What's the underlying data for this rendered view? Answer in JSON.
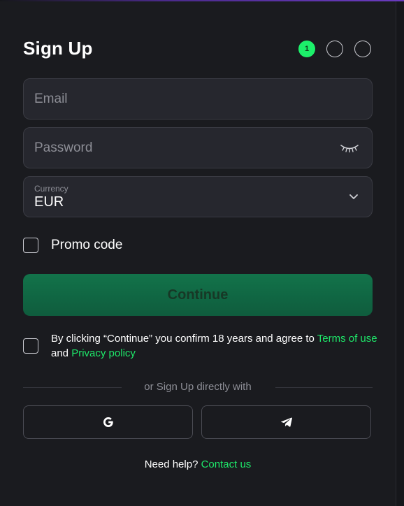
{
  "form": {
    "title": "Sign Up",
    "steps": [
      {
        "label": "1",
        "active": true
      },
      {
        "label": "",
        "active": false
      },
      {
        "label": "",
        "active": false
      }
    ],
    "email": {
      "placeholder": "Email"
    },
    "password": {
      "placeholder": "Password",
      "toggle_icon": "eye-closed-icon"
    },
    "currency": {
      "label": "Currency",
      "value": "EUR",
      "icon": "chevron-down-icon"
    },
    "promo": {
      "label": "Promo code",
      "checked": false
    },
    "continue_label": "Continue",
    "terms": {
      "checked": false,
      "text_before": "By clicking “Continue” you confirm 18 years and agree to ",
      "terms_link": "Terms of use",
      "text_middle": " and ",
      "privacy_link": "Privacy policy"
    },
    "social": {
      "divider_text": "or Sign Up directly with",
      "buttons": [
        {
          "name": "google",
          "icon": "google-icon"
        },
        {
          "name": "telegram",
          "icon": "telegram-icon"
        }
      ]
    },
    "help": {
      "text": "Need help? ",
      "link": "Contact us"
    }
  },
  "colors": {
    "accent": "#1cf06a",
    "link": "#1ee86a",
    "button_bg": "#0f5c3d",
    "background": "#1a1b1f",
    "field_bg": "#26272e"
  }
}
